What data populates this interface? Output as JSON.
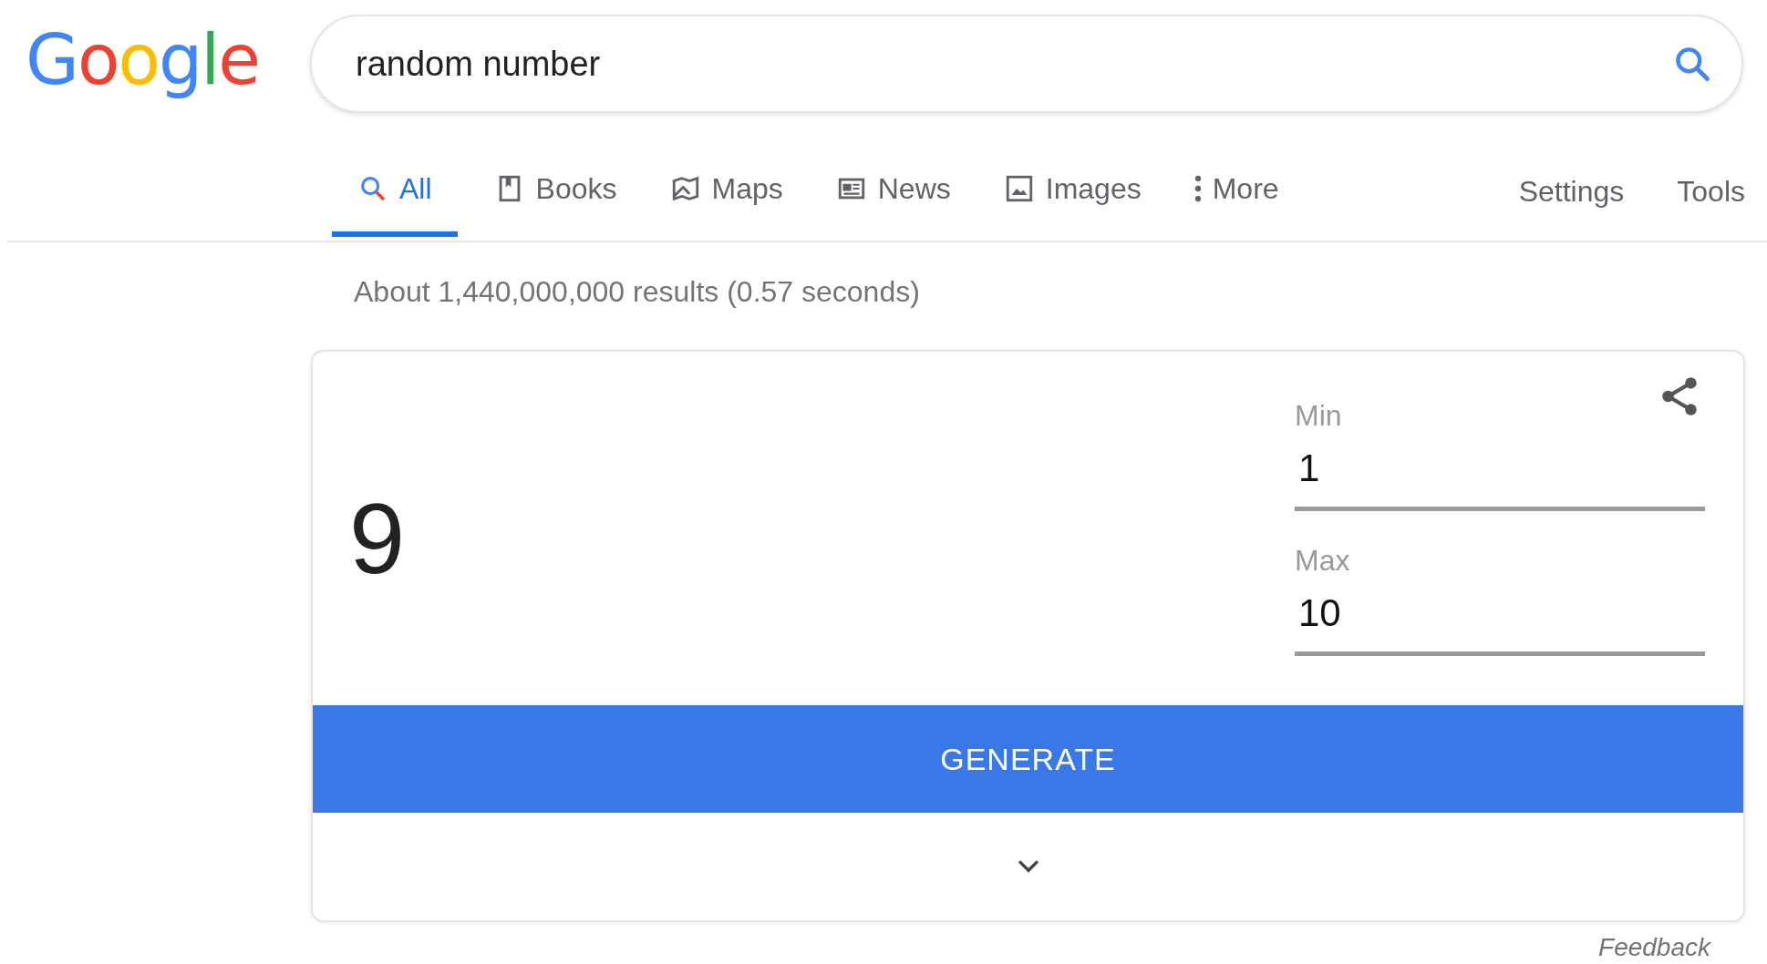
{
  "logo": {
    "text": "Google"
  },
  "search": {
    "value": "random number"
  },
  "tabs": [
    {
      "label": "All",
      "kind": "search",
      "selected": true
    },
    {
      "label": "Books",
      "kind": "book",
      "selected": false
    },
    {
      "label": "Maps",
      "kind": "map",
      "selected": false
    },
    {
      "label": "News",
      "kind": "news",
      "selected": false
    },
    {
      "label": "Images",
      "kind": "image",
      "selected": false
    },
    {
      "label": "More",
      "kind": "dots",
      "selected": false
    }
  ],
  "tools": [
    "Settings",
    "Tools"
  ],
  "result_stats": "About 1,440,000,000 results (0.57 seconds)",
  "generator": {
    "result": "9",
    "min": {
      "label": "Min",
      "value": "1"
    },
    "max": {
      "label": "Max",
      "value": "10"
    },
    "button": "GENERATE"
  },
  "feedback": "Feedback"
}
